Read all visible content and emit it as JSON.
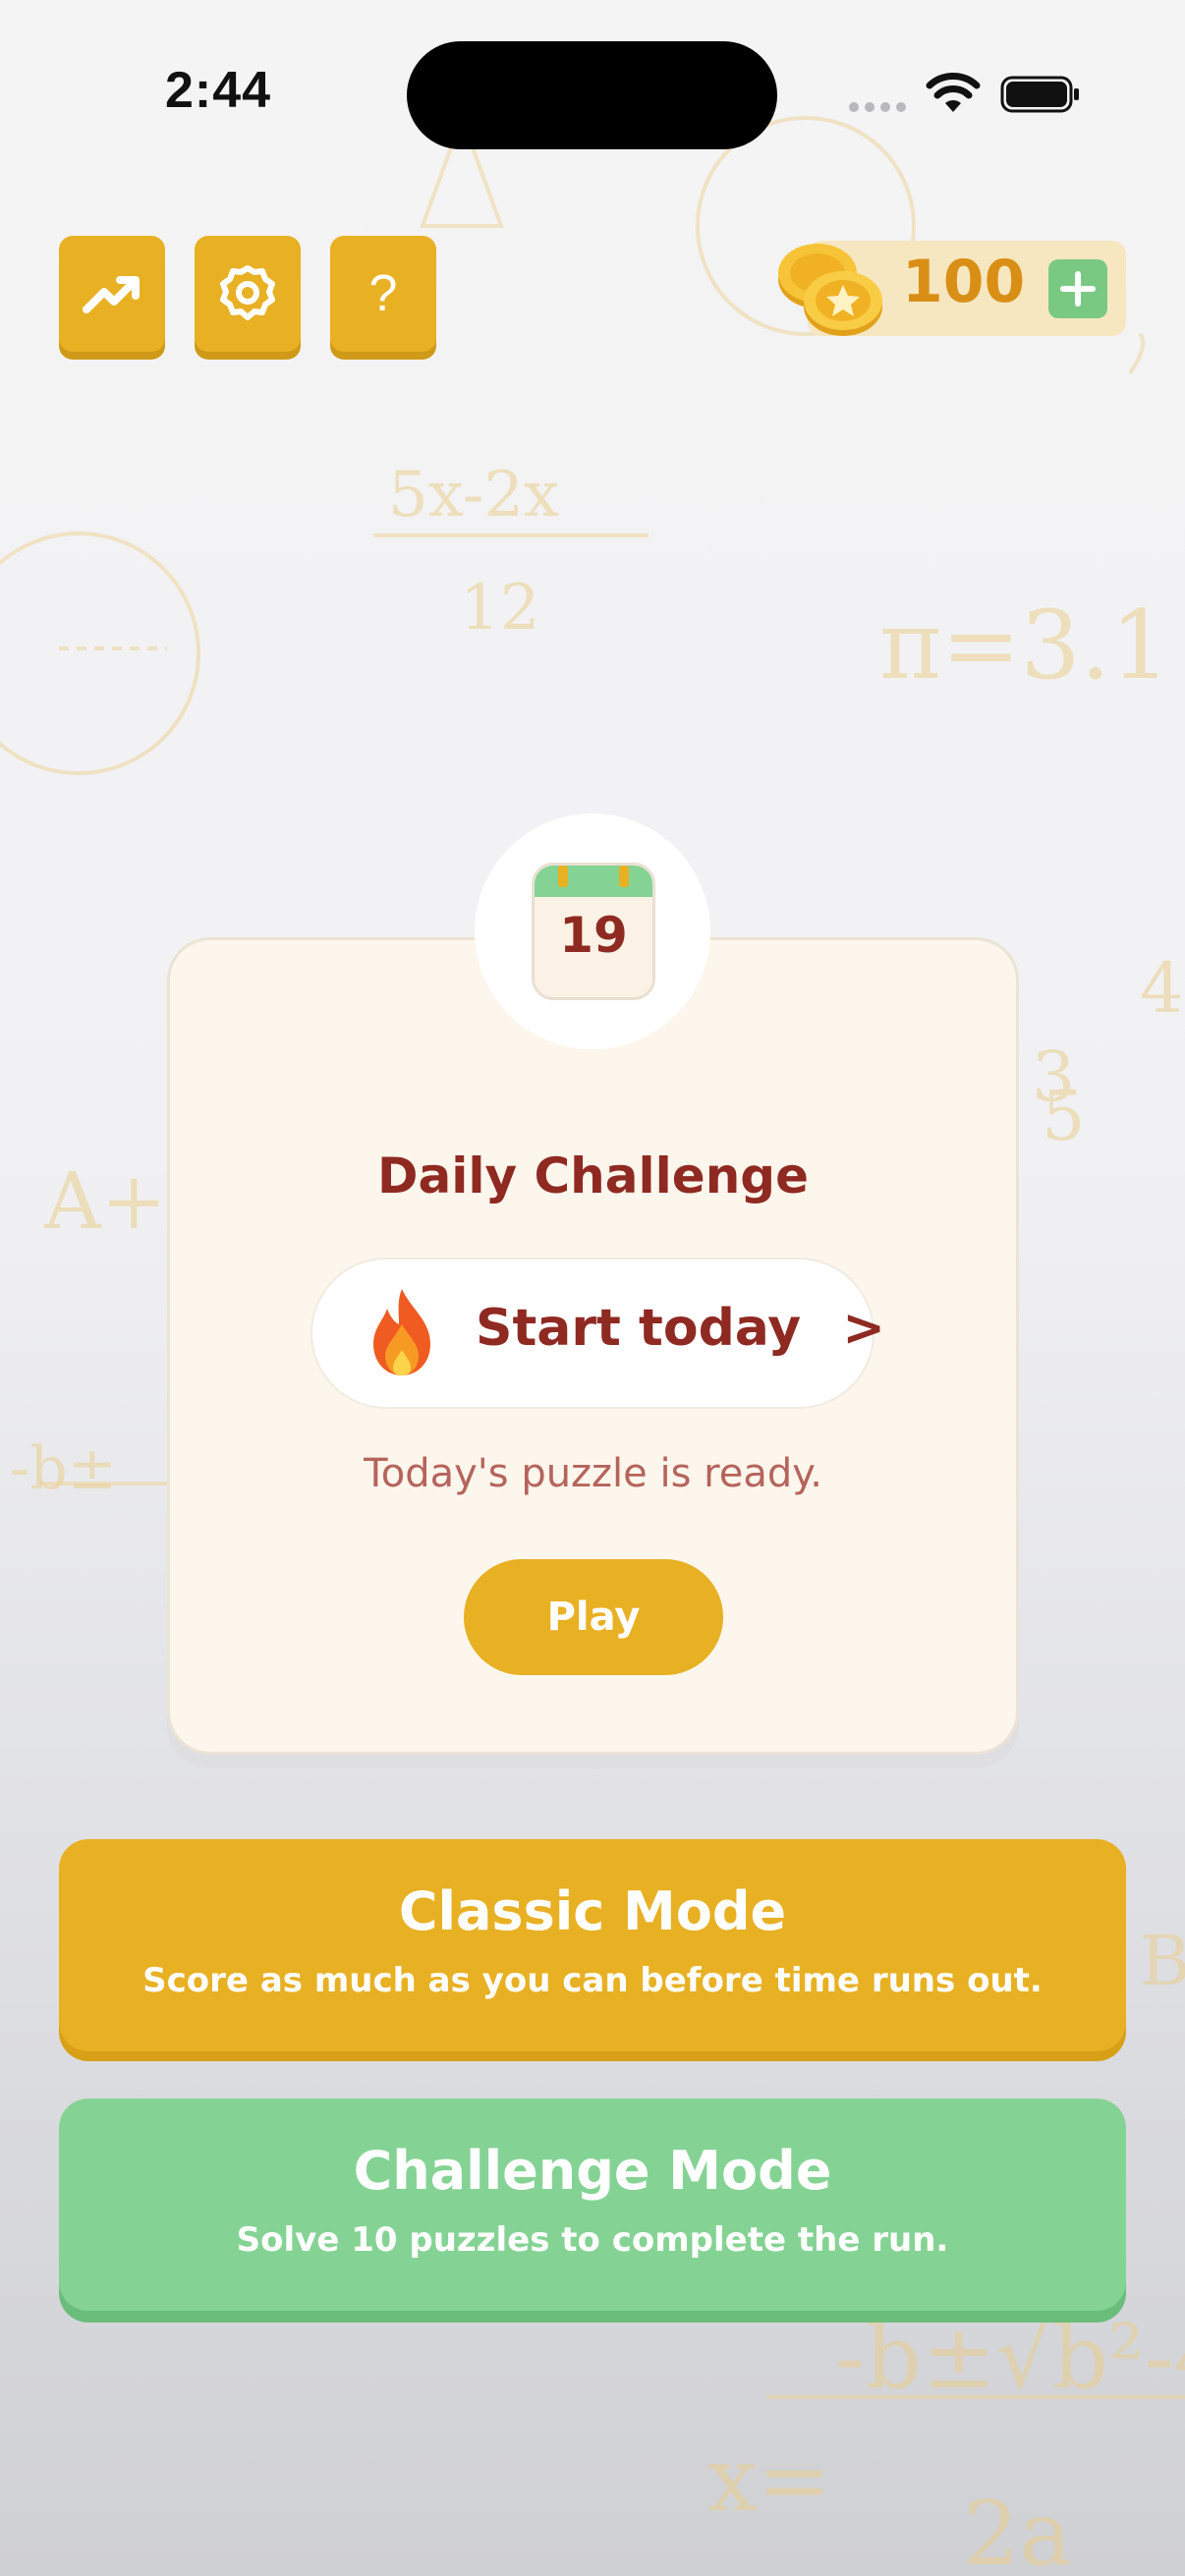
{
  "status_bar": {
    "time": "2:44"
  },
  "toolbar": {
    "stats_icon": "trending-up-icon",
    "settings_icon": "gear-icon",
    "help_label": "?"
  },
  "coins": {
    "value": "100",
    "add_label": "+"
  },
  "daily_challenge": {
    "calendar_day": "19",
    "title": "Daily Challenge",
    "streak_label": "Start today",
    "streak_chevron": ">",
    "status": "Today's puzzle is ready.",
    "play_label": "Play"
  },
  "modes": [
    {
      "title": "Classic Mode",
      "subtitle": "Score as much as you can before time runs out."
    },
    {
      "title": "Challenge Mode",
      "subtitle": "Solve 10 puzzles to complete the run."
    }
  ],
  "colors": {
    "accent_yellow": "#e8b023",
    "accent_green": "#85d394",
    "title_red": "#8e2a22",
    "coin_text": "#d98f16"
  }
}
